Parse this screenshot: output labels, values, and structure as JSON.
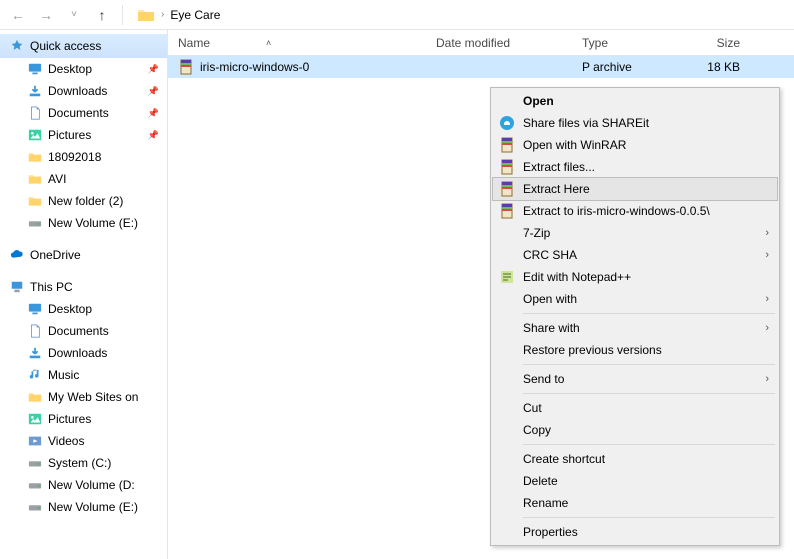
{
  "toolbar": {
    "folder_name": "Eye Care"
  },
  "sidebar": {
    "quick_access": "Quick access",
    "qa_items": [
      {
        "label": "Desktop",
        "icon": "desktop"
      },
      {
        "label": "Downloads",
        "icon": "downloads"
      },
      {
        "label": "Documents",
        "icon": "documents"
      },
      {
        "label": "Pictures",
        "icon": "pictures"
      },
      {
        "label": "18092018",
        "icon": "folder"
      },
      {
        "label": "AVI",
        "icon": "folder"
      },
      {
        "label": "New folder (2)",
        "icon": "folder"
      },
      {
        "label": "New Volume (E:)",
        "icon": "drive"
      }
    ],
    "onedrive": "OneDrive",
    "thispc": "This PC",
    "pc_items": [
      {
        "label": "Desktop",
        "icon": "desktop"
      },
      {
        "label": "Documents",
        "icon": "documents"
      },
      {
        "label": "Downloads",
        "icon": "downloads"
      },
      {
        "label": "Music",
        "icon": "music"
      },
      {
        "label": "My Web Sites on",
        "icon": "folder"
      },
      {
        "label": "Pictures",
        "icon": "pictures"
      },
      {
        "label": "Videos",
        "icon": "videos"
      },
      {
        "label": "System (C:)",
        "icon": "drive"
      },
      {
        "label": "New Volume (D:",
        "icon": "drive"
      },
      {
        "label": "New Volume (E:)",
        "icon": "drive"
      }
    ]
  },
  "columns": {
    "name": "Name",
    "date": "Date modified",
    "type": "Type",
    "size": "Size"
  },
  "file": {
    "name": "iris-micro-windows-0",
    "type_suffix": "P archive",
    "size": "18 KB"
  },
  "context_menu": {
    "open": "Open",
    "shareit": "Share files via SHAREit",
    "openwinrar": "Open with WinRAR",
    "extractfiles": "Extract files...",
    "extracthere": "Extract Here",
    "extractto": "Extract to iris-micro-windows-0.0.5\\",
    "sevenzip": "7-Zip",
    "crcsha": "CRC SHA",
    "notepadpp": "Edit with Notepad++",
    "openwith": "Open with",
    "sharewith": "Share with",
    "restore": "Restore previous versions",
    "sendto": "Send to",
    "cut": "Cut",
    "copy": "Copy",
    "createshortcut": "Create shortcut",
    "delete": "Delete",
    "rename": "Rename",
    "properties": "Properties"
  }
}
